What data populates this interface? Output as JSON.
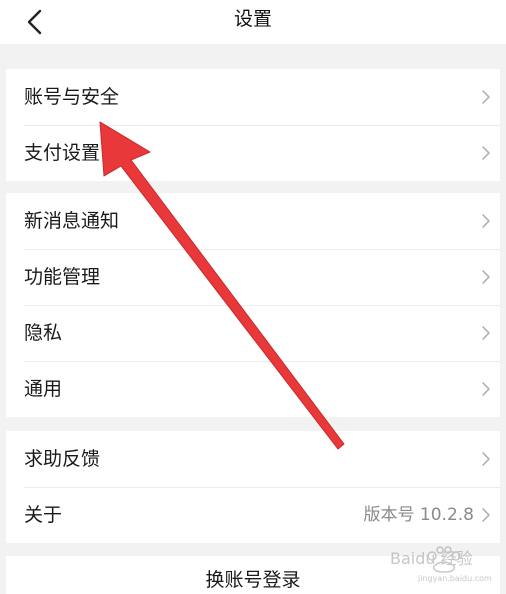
{
  "header": {
    "title": "设置",
    "back_icon": "chevron-left-icon"
  },
  "groups": [
    {
      "items": [
        {
          "label": "账号与安全",
          "value": ""
        },
        {
          "label": "支付设置",
          "value": ""
        }
      ]
    },
    {
      "items": [
        {
          "label": "新消息通知",
          "value": ""
        },
        {
          "label": "功能管理",
          "value": ""
        },
        {
          "label": "隐私",
          "value": ""
        },
        {
          "label": "通用",
          "value": ""
        }
      ]
    },
    {
      "items": [
        {
          "label": "求助反馈",
          "value": ""
        },
        {
          "label": "关于",
          "value": "版本号 10.2.8"
        }
      ]
    }
  ],
  "footer": {
    "switch_account_label": "换账号登录"
  },
  "annotation": {
    "arrow_color": "#e8383a"
  },
  "watermark": {
    "text": "Baidu 经验",
    "url_text": "jingyan.baidu.com"
  }
}
